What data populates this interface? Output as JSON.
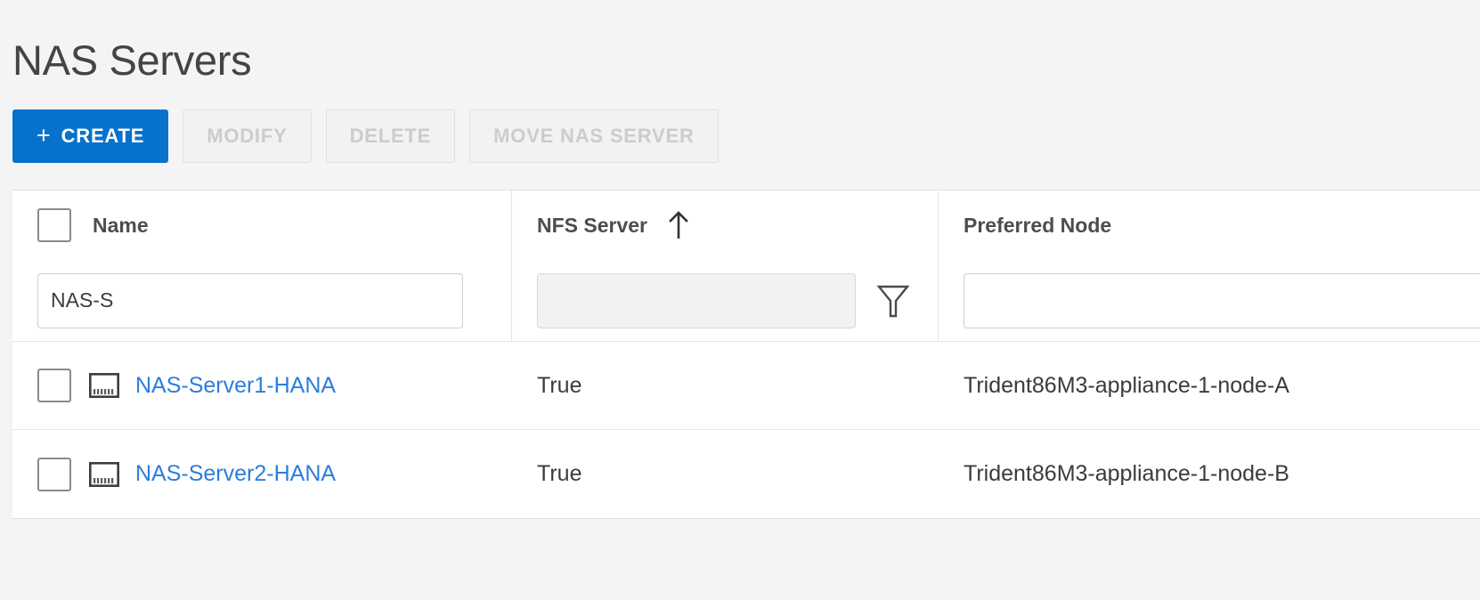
{
  "page": {
    "title": "NAS Servers",
    "background_color": "#f4f4f4"
  },
  "toolbar": {
    "create_label": "CREATE",
    "create_plus": "+",
    "modify_label": "MODIFY",
    "delete_label": "DELETE",
    "move_label": "MOVE NAS SERVER",
    "primary_color": "#0672cb",
    "disabled_text_color": "#cccccc"
  },
  "table": {
    "columns": [
      {
        "key": "name",
        "label": "Name",
        "sorted": false
      },
      {
        "key": "nfs_server",
        "label": "NFS Server",
        "sorted": true,
        "sort_direction": "ascending",
        "sort_icon": "arrow-up-icon"
      },
      {
        "key": "preferred_node",
        "label": "Preferred Node",
        "sorted": false
      }
    ],
    "select_all_checkbox": {
      "checked": false
    },
    "filters": {
      "name": {
        "value": "NAS-S",
        "placeholder": "",
        "disabled": false
      },
      "nfs_server": {
        "value": "",
        "placeholder": "",
        "disabled": true,
        "icon": "funnel-icon"
      },
      "preferred_node": {
        "value": "",
        "placeholder": "",
        "disabled": false
      }
    },
    "rows": [
      {
        "checked": false,
        "icon": "nas-server-icon",
        "name": "NAS-Server1-HANA",
        "nfs_server": "True",
        "preferred_node": "Trident86M3-appliance-1-node-A",
        "link_color": "#2a7ede"
      },
      {
        "checked": false,
        "icon": "nas-server-icon",
        "name": "NAS-Server2-HANA",
        "nfs_server": "True",
        "preferred_node": "Trident86M3-appliance-1-node-B",
        "link_color": "#2a7ede"
      }
    ]
  }
}
